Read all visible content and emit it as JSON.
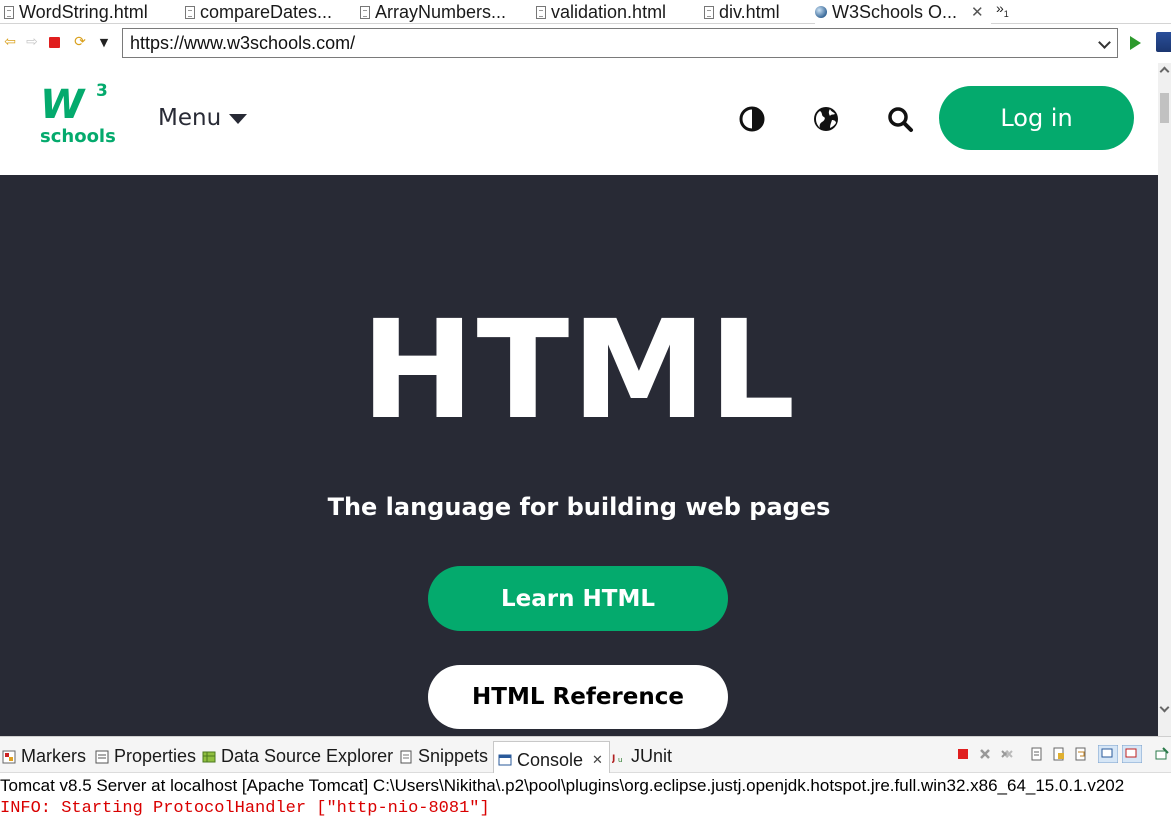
{
  "editor_tabs": [
    {
      "label": "WordString.html",
      "active": false
    },
    {
      "label": "compareDates...",
      "active": false
    },
    {
      "label": "ArrayNumbers...",
      "active": false
    },
    {
      "label": "validation.html",
      "active": false
    },
    {
      "label": "div.html",
      "active": false
    },
    {
      "label": "W3Schools O...",
      "active": true
    }
  ],
  "tab_overflow": {
    "symbol": "»",
    "count": "1"
  },
  "browser": {
    "url": "https://www.w3schools.com/"
  },
  "site": {
    "logo": {
      "mark": "W",
      "sup": "3",
      "word": "schools"
    },
    "menu_label": "Menu",
    "login_label": "Log in",
    "icons": [
      "contrast-icon",
      "globe-icon",
      "search-icon"
    ],
    "hero": {
      "title": "HTML",
      "subtitle": "The language for building web pages",
      "primary_button": "Learn HTML",
      "secondary_button": "HTML Reference"
    },
    "colors": {
      "brand_green": "#04aa6d",
      "hero_bg": "#282a35",
      "white": "#ffffff"
    }
  },
  "views": {
    "tabs": [
      {
        "label": "Markers",
        "active": false
      },
      {
        "label": "Properties",
        "active": false
      },
      {
        "label": "Data Source Explorer",
        "active": false
      },
      {
        "label": "Snippets",
        "active": false
      },
      {
        "label": "Console",
        "active": true
      },
      {
        "label": "JUnit",
        "active": false
      }
    ],
    "console": {
      "header": "Tomcat v8.5 Server at localhost [Apache Tomcat] C:\\Users\\Nikitha\\.p2\\pool\\plugins\\org.eclipse.justj.openjdk.hotspot.jre.full.win32.x86_64_15.0.1.v202",
      "line": "INFO: Starting ProtocolHandler [\"http-nio-8081\"]"
    }
  }
}
